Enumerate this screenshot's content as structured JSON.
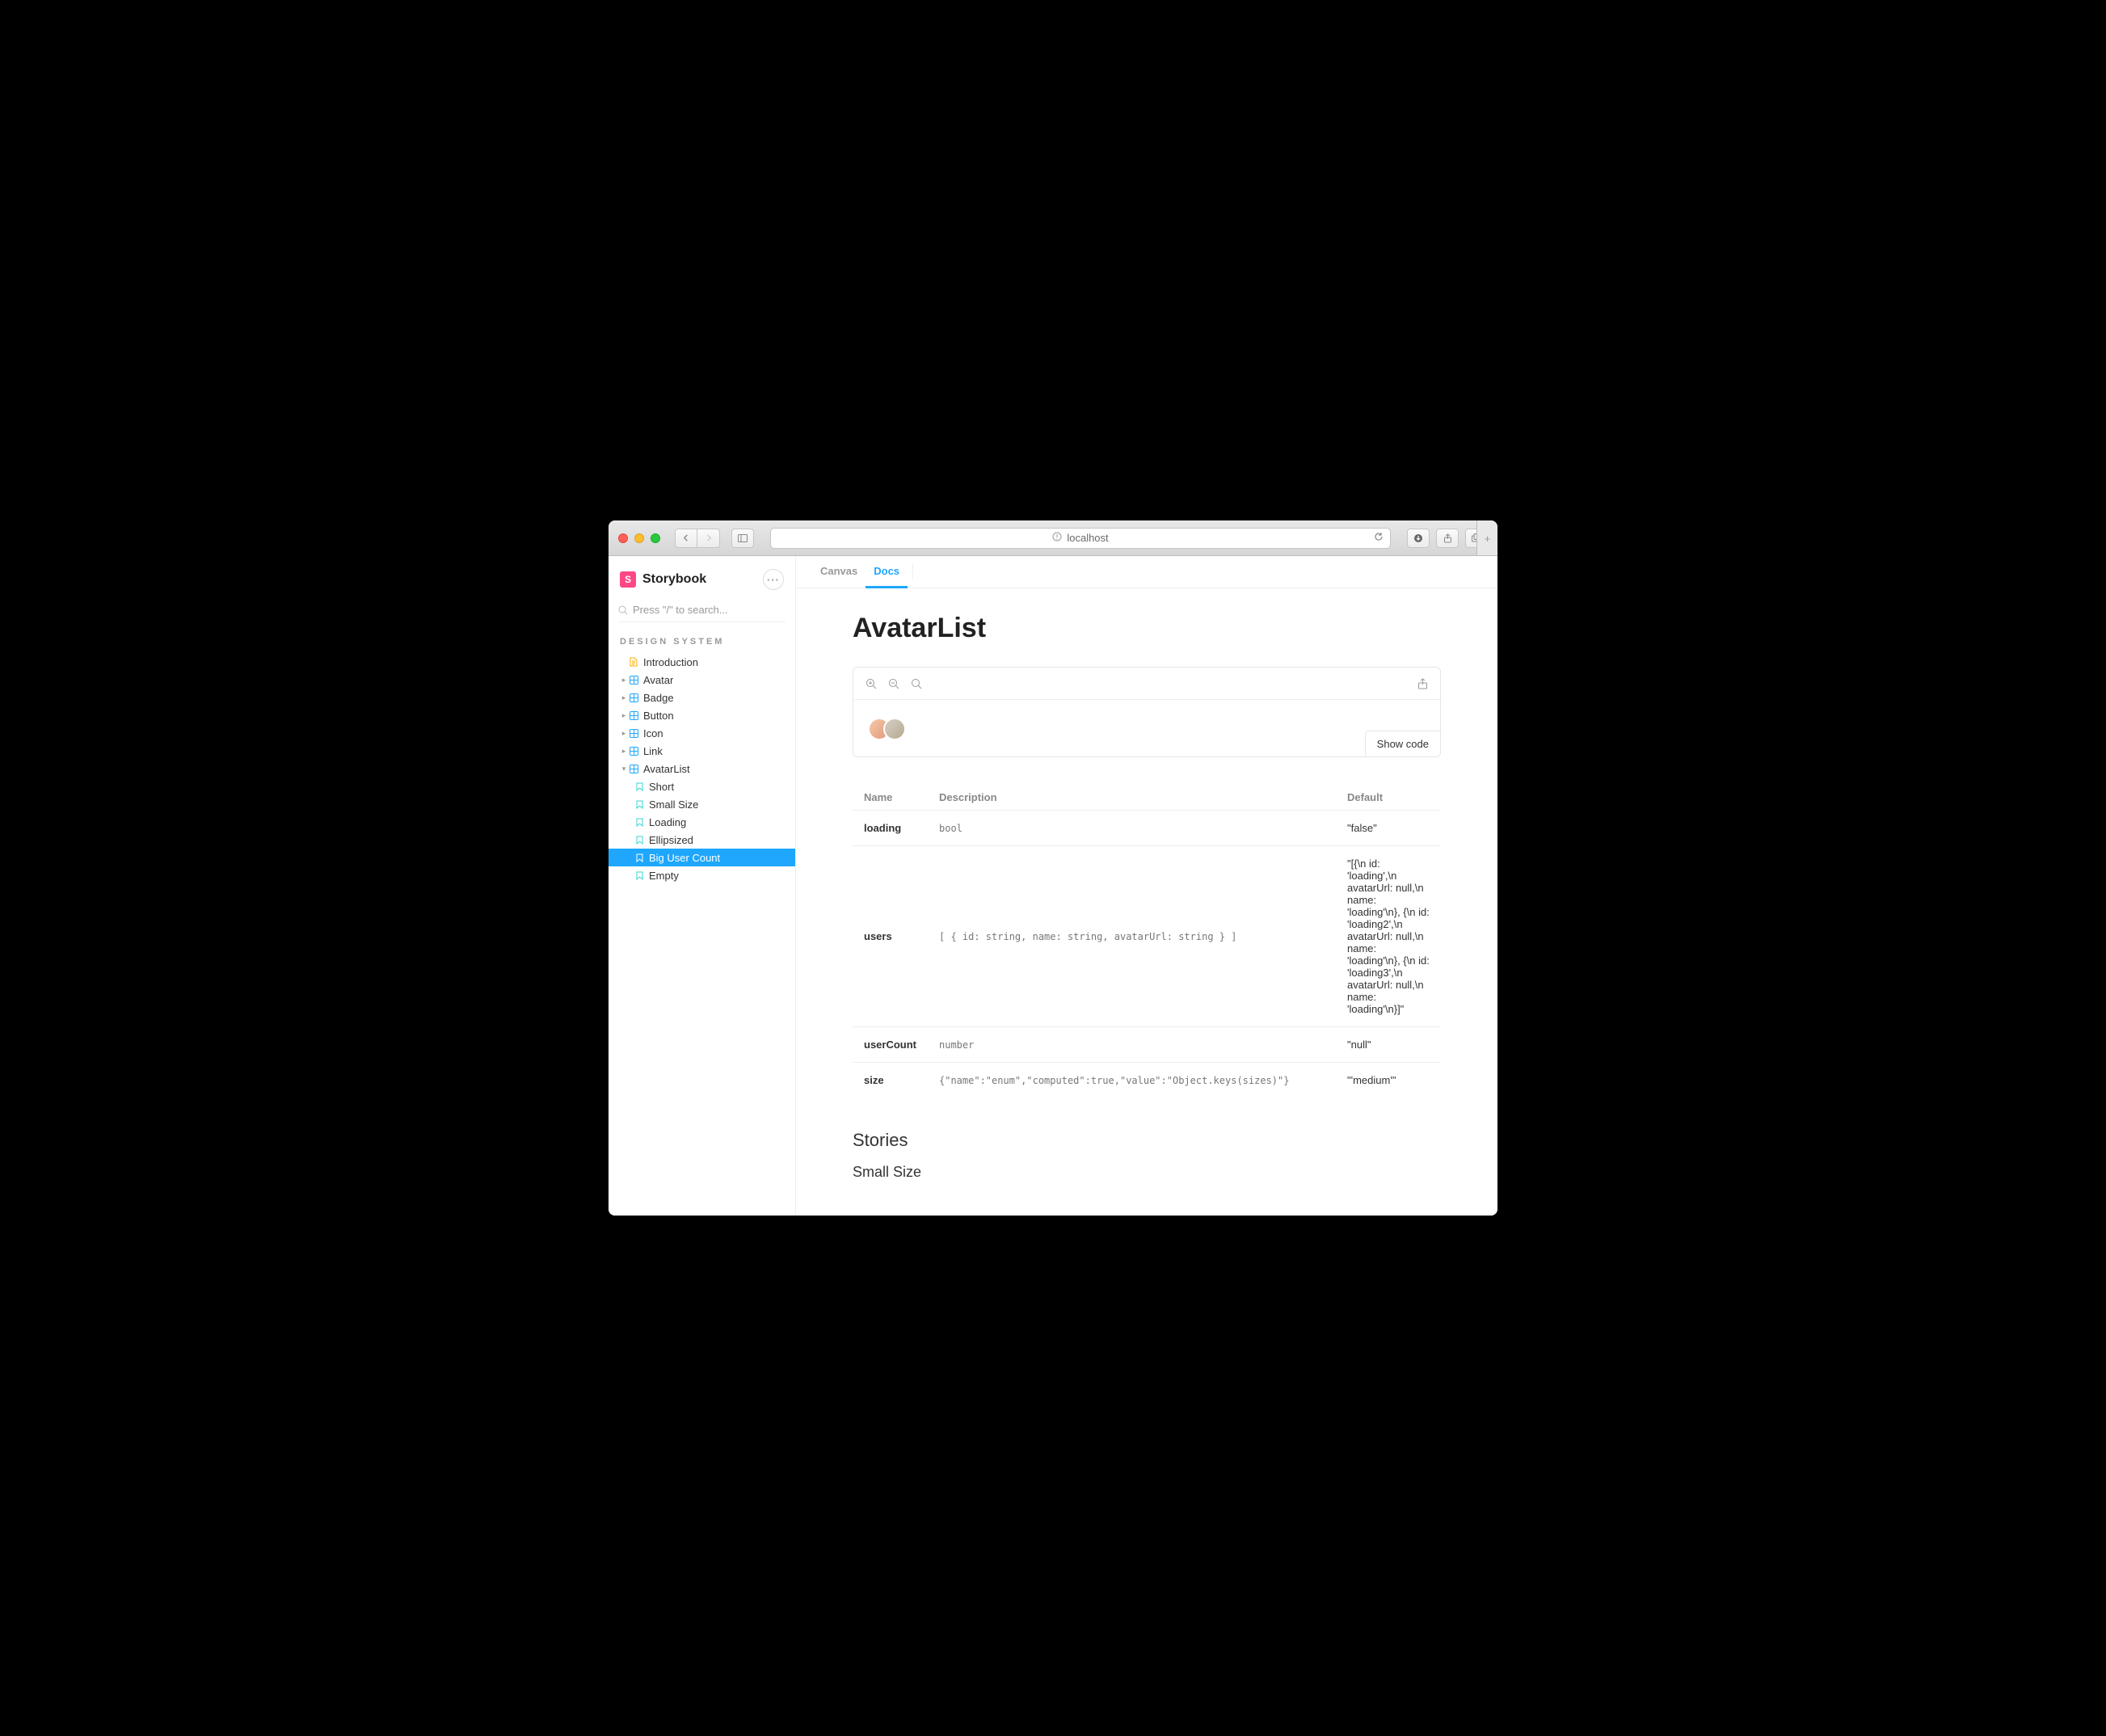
{
  "browser": {
    "url": "localhost"
  },
  "sidebar": {
    "app_name": "Storybook",
    "search_placeholder": "Press \"/\" to search...",
    "section_label": "DESIGN SYSTEM",
    "tree": [
      {
        "type": "doc",
        "label": "Introduction",
        "expanded": false,
        "selected": false
      },
      {
        "type": "component",
        "label": "Avatar",
        "expanded": false,
        "selected": false,
        "hasCaret": true
      },
      {
        "type": "component",
        "label": "Badge",
        "expanded": false,
        "selected": false,
        "hasCaret": true
      },
      {
        "type": "component",
        "label": "Button",
        "expanded": false,
        "selected": false,
        "hasCaret": true
      },
      {
        "type": "component",
        "label": "Icon",
        "expanded": false,
        "selected": false,
        "hasCaret": true
      },
      {
        "type": "component",
        "label": "Link",
        "expanded": false,
        "selected": false,
        "hasCaret": true
      },
      {
        "type": "component",
        "label": "AvatarList",
        "expanded": true,
        "selected": false,
        "hasCaret": true,
        "children": [
          {
            "type": "story",
            "label": "Short",
            "selected": false
          },
          {
            "type": "story",
            "label": "Small Size",
            "selected": false
          },
          {
            "type": "story",
            "label": "Loading",
            "selected": false
          },
          {
            "type": "story",
            "label": "Ellipsized",
            "selected": false
          },
          {
            "type": "story",
            "label": "Big User Count",
            "selected": true
          },
          {
            "type": "story",
            "label": "Empty",
            "selected": false
          }
        ]
      }
    ]
  },
  "tabs": [
    {
      "label": "Canvas",
      "active": false
    },
    {
      "label": "Docs",
      "active": true
    }
  ],
  "doc": {
    "title": "AvatarList",
    "show_code_label": "Show code",
    "columns": {
      "name": "Name",
      "description": "Description",
      "default": "Default"
    },
    "props": [
      {
        "name": "loading",
        "description": "bool",
        "default": "\"false\""
      },
      {
        "name": "users",
        "description": "[ { id: string, name: string, avatarUrl: string } ]",
        "default": "\"[{\\n id: 'loading',\\n avatarUrl: null,\\n name: 'loading'\\n}, {\\n id: 'loading2',\\n avatarUrl: null,\\n name: 'loading'\\n}, {\\n id: 'loading3',\\n avatarUrl: null,\\n name: 'loading'\\n}]\""
      },
      {
        "name": "userCount",
        "description": "number",
        "default": "\"null\""
      },
      {
        "name": "size",
        "description": "{\"name\":\"enum\",\"computed\":true,\"value\":\"Object.keys(sizes)\"}",
        "default": "\"'medium'\""
      }
    ],
    "stories_heading": "Stories",
    "first_story_heading": "Small Size"
  }
}
